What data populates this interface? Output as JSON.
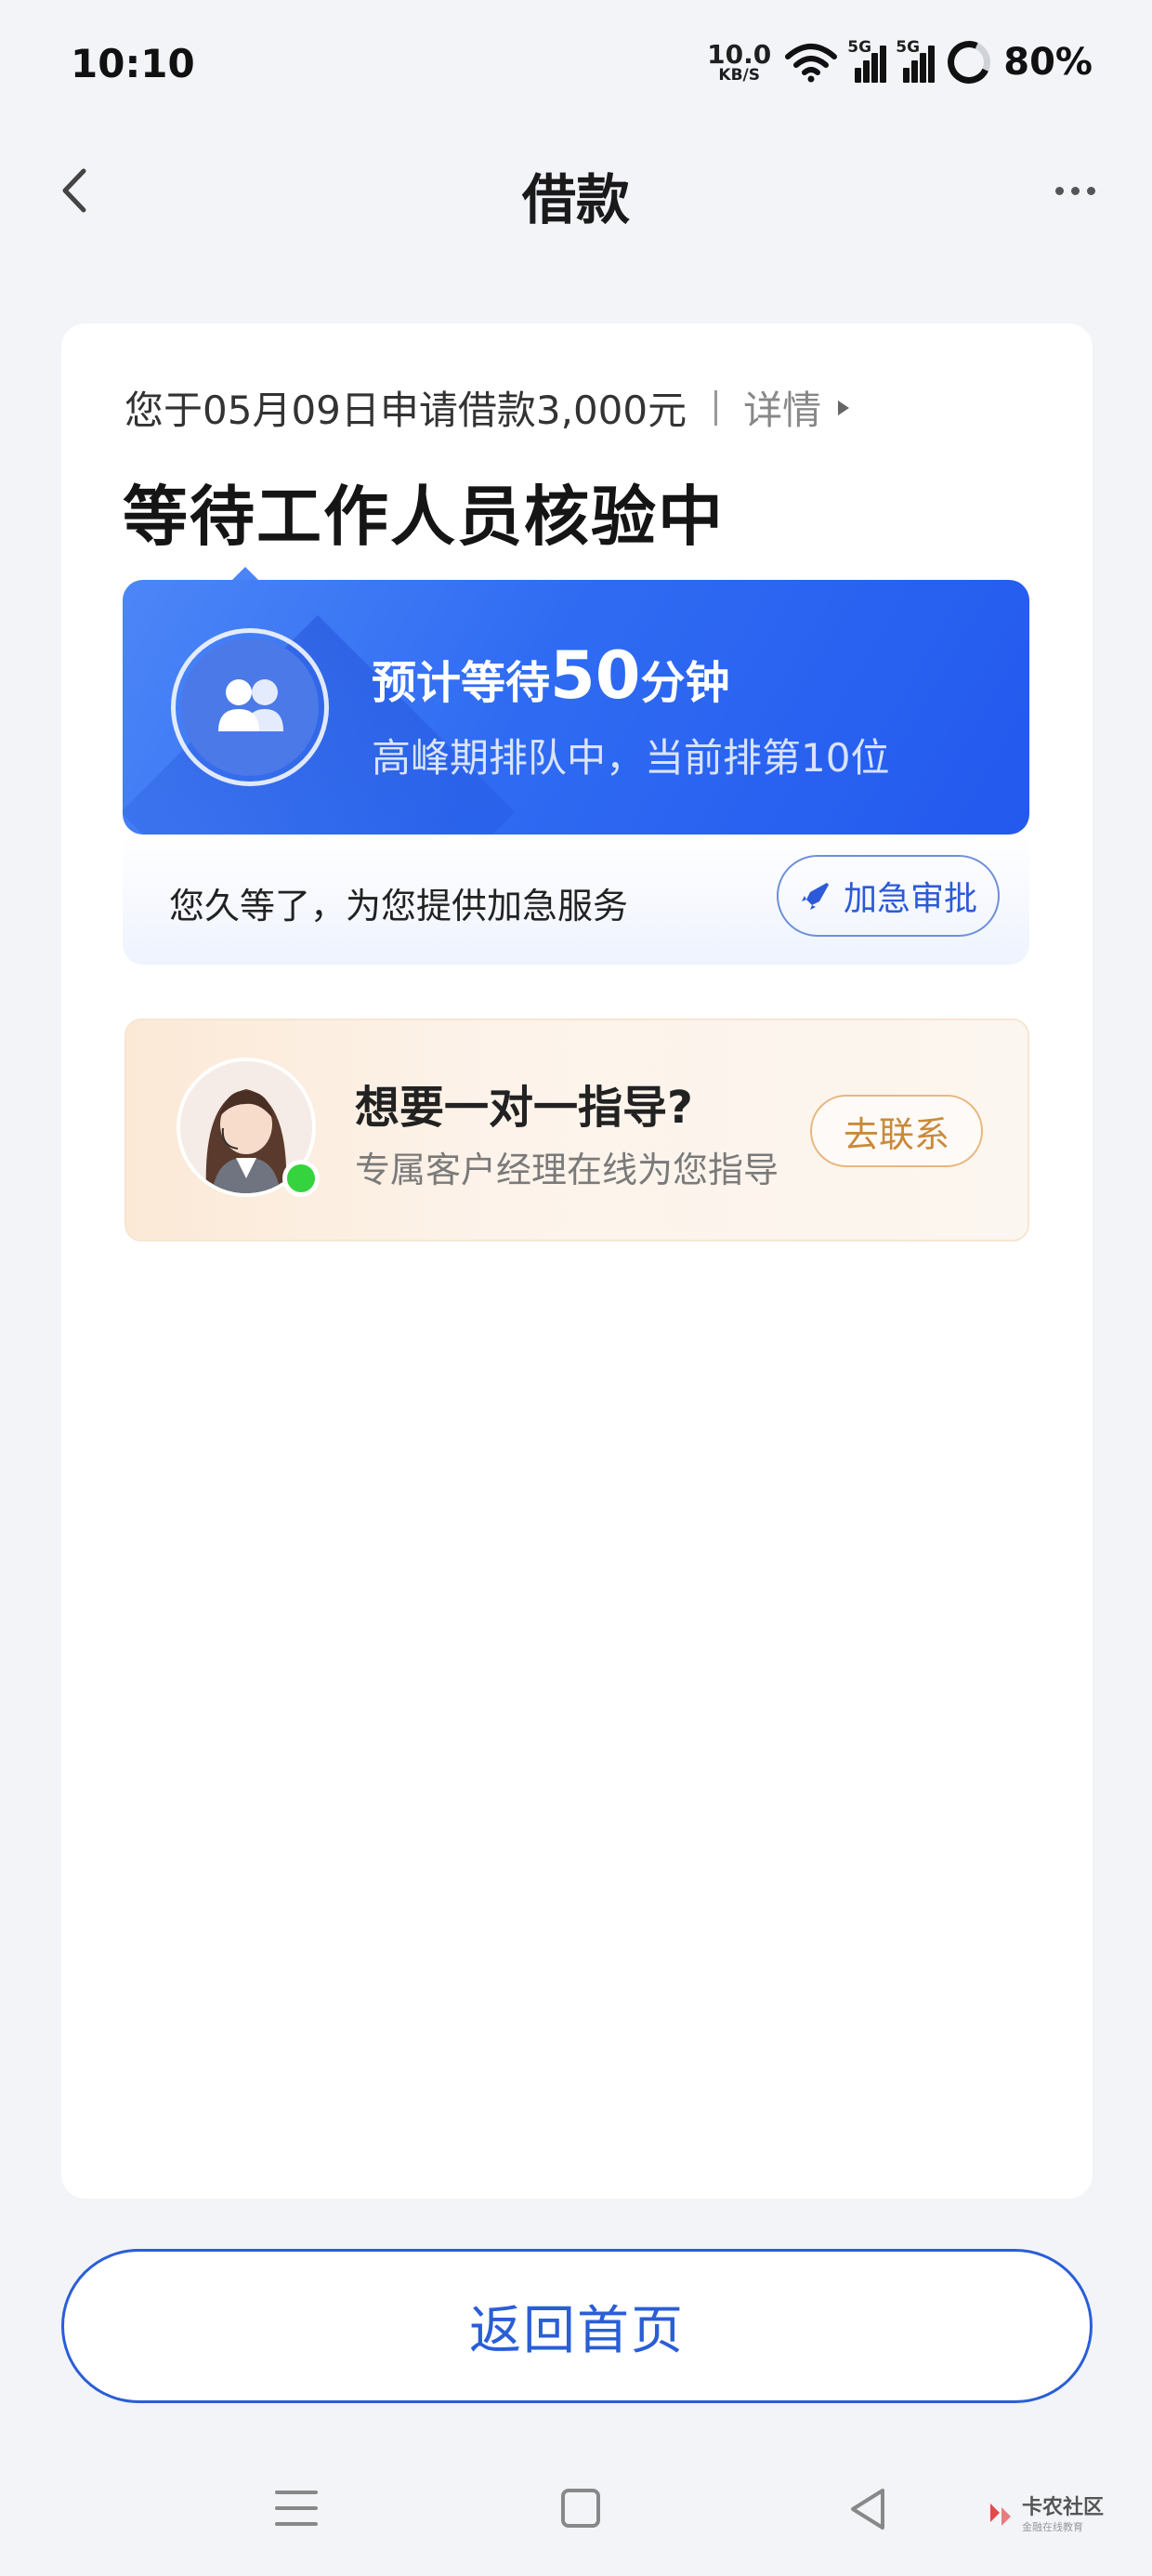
{
  "status_bar": {
    "time": "10:10",
    "net_speed": "10.0",
    "net_unit": "KB/S",
    "signal_1": "5G",
    "signal_2": "5G",
    "battery": "80%"
  },
  "header": {
    "title": "借款",
    "back_icon": "chevron-left-icon",
    "more_icon": "more-dots-icon"
  },
  "application": {
    "summary": "您于05月09日申请借款3,000元",
    "detail_link": "详情",
    "status_title": "等待工作人员核验中"
  },
  "wait_info": {
    "prefix": "预计等待",
    "minutes": "50",
    "suffix": "分钟",
    "queue_text": "高峰期排队中，当前排第10位"
  },
  "urgent": {
    "text": "您久等了，为您提供加急服务",
    "button_label": "加急审批",
    "button_icon": "rocket-icon"
  },
  "guide": {
    "title": "想要一对一指导?",
    "subtitle": "专属客户经理在线为您指导",
    "button_label": "去联系"
  },
  "footer": {
    "home_button": "返回首页"
  },
  "watermark": {
    "main": "卡农社区",
    "sub": "金融在线教育"
  },
  "colors": {
    "primary": "#2a5ed6",
    "wait_gradient_start": "#4c86f7",
    "wait_gradient_end": "#2359ee",
    "contact_orange": "#c98a3b",
    "online_green": "#35d43f"
  }
}
